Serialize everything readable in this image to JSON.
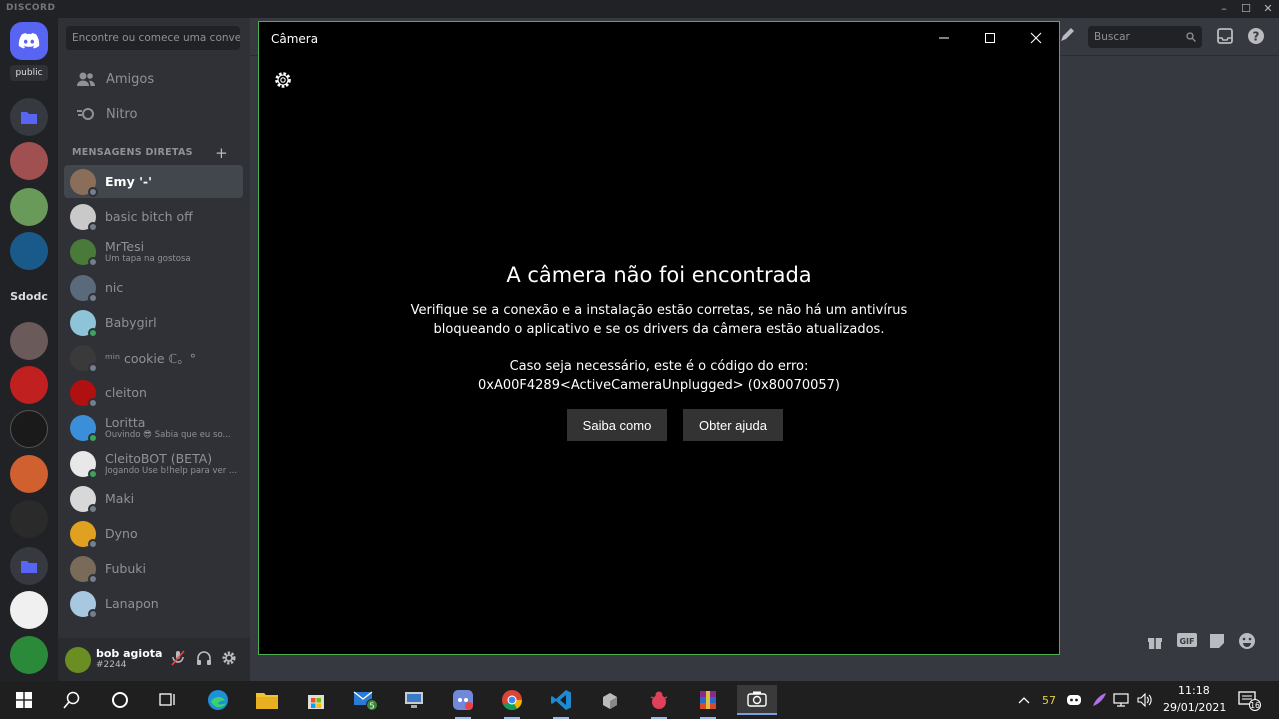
{
  "discord": {
    "brand": "DISCORD",
    "home_label": "public",
    "server_text": "Sdodc",
    "search_placeholder": "Encontre ou comece uma conversa",
    "nav": [
      {
        "label": "Amigos"
      },
      {
        "label": "Nitro"
      }
    ],
    "dm_header": "MENSAGENS DIRETAS",
    "dms": [
      {
        "name": "Emy '-'",
        "sub": "",
        "color": "#8a6e5a",
        "online": false,
        "selected": true
      },
      {
        "name": "basic bitch off",
        "sub": "",
        "color": "#c9c9c9",
        "online": false,
        "selected": false
      },
      {
        "name": "MrTesi",
        "sub": "Um tapa na gostosa",
        "color": "#4a7a3a",
        "online": false,
        "selected": false
      },
      {
        "name": "nic",
        "sub": "",
        "color": "#5a6a7a",
        "online": false,
        "selected": false
      },
      {
        "name": "Babygirl",
        "sub": "",
        "color": "#8fc4d8",
        "online": true,
        "selected": false
      },
      {
        "name": "ᵐⁱⁿ cookie ℂ。°",
        "sub": "",
        "color": "#3a3a3a",
        "online": false,
        "selected": false
      },
      {
        "name": "cleiton",
        "sub": "",
        "color": "#b01010",
        "online": false,
        "selected": false
      },
      {
        "name": "Loritta",
        "sub": "Ouvindo 😎 Sabia que eu so...",
        "color": "#3a8fd8",
        "online": true,
        "selected": false
      },
      {
        "name": "CleitoBOT (BETA)",
        "sub": "Jogando Use b!help para ver ...",
        "color": "#e8e8e8",
        "online": true,
        "selected": false
      },
      {
        "name": "Maki",
        "sub": "",
        "color": "#d8d8d8",
        "online": false,
        "selected": false
      },
      {
        "name": "Dyno",
        "sub": "",
        "color": "#e0a020",
        "online": false,
        "selected": false
      },
      {
        "name": "Fubuki",
        "sub": "",
        "color": "#7a6a5a",
        "online": false,
        "selected": false
      },
      {
        "name": "Lanapon",
        "sub": "",
        "color": "#a8c8e0",
        "online": false,
        "selected": false
      }
    ],
    "user": {
      "name": "bob agiota",
      "tag": "#2244"
    },
    "header_search": "Buscar"
  },
  "camera": {
    "title": "Câmera",
    "heading": "A câmera não foi encontrada",
    "body_line1": "Verifique se a conexão e a instalação estão corretas, se não há um antivírus",
    "body_line2": "bloqueando o aplicativo e se os drivers da câmera estão atualizados.",
    "code_line1": "Caso seja necessário, este é o código do erro:",
    "code_line2": "0xA00F4289<ActiveCameraUnplugged> (0x80070057)",
    "btn_learn": "Saiba como",
    "btn_help": "Obter ajuda"
  },
  "taskbar": {
    "mail_badge": "5",
    "tray_temp": "57",
    "time": "11:18",
    "date": "29/01/2021",
    "notif_count": "16"
  }
}
